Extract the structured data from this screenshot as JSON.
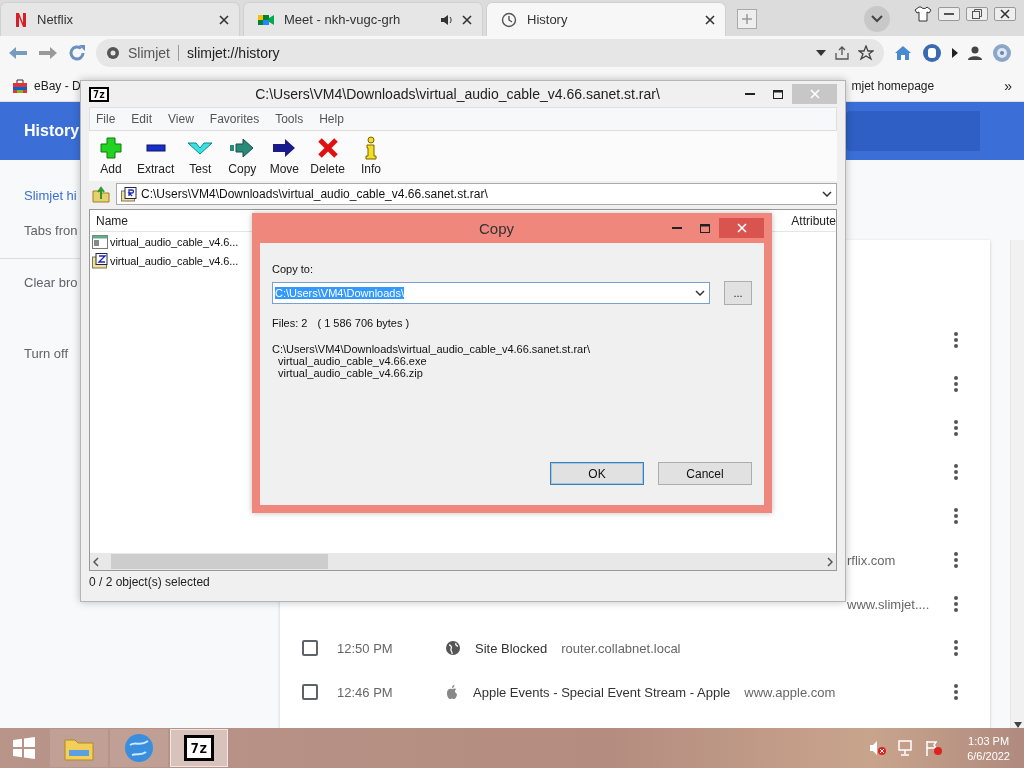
{
  "tabs": [
    {
      "label": "Netflix",
      "kind": "netflix",
      "selected": false,
      "audio": false
    },
    {
      "label": "Meet - nkh-vugc-grh",
      "kind": "meet",
      "selected": false,
      "audio": true
    },
    {
      "label": "History",
      "kind": "history",
      "selected": true,
      "audio": false
    }
  ],
  "address_bar": {
    "site": "Slimjet",
    "url": "slimjet://history"
  },
  "bookmarks": [
    {
      "label": "eBay - D",
      "kind": "ebay"
    },
    {
      "label": "mjet homepage",
      "kind": "covered"
    }
  ],
  "bookmarks_overflow": "»",
  "history_page": {
    "title": "History",
    "sidebar": [
      {
        "label": "Slimjet hi",
        "selected": true
      },
      {
        "label": "Tabs fron",
        "selected": false
      },
      {
        "label": "Clear bro",
        "selected": false
      },
      {
        "label": "Turn off",
        "selected": false
      }
    ],
    "rows": [
      {
        "kind": "covered"
      },
      {
        "kind": "covered"
      },
      {
        "kind": "covered"
      },
      {
        "kind": "covered"
      },
      {
        "kind": "covered"
      },
      {
        "kind": "covered",
        "tail": "rflix.com"
      },
      {
        "kind": "covered",
        "tail": "www.slimjet...."
      },
      {
        "kind": "full",
        "time": "12:50 PM",
        "favicon": {
          "kind": "globe"
        },
        "title": "Site Blocked",
        "domain": "router.collabnet.local",
        "checked": false
      },
      {
        "kind": "full",
        "time": "12:46 PM",
        "favicon": {
          "kind": "apple"
        },
        "title": "Apple Events - Special Event Stream - Apple",
        "domain": "www.apple.com",
        "checked": false
      }
    ]
  },
  "archive_window": {
    "icon_text": "7z",
    "title": "C:\\Users\\VM4\\Downloads\\virtual_audio_cable_v4.66.sanet.st.rar\\",
    "menu": [
      "File",
      "Edit",
      "View",
      "Favorites",
      "Tools",
      "Help"
    ],
    "toolbar": [
      {
        "label": "Add",
        "kind": "add"
      },
      {
        "label": "Extract",
        "kind": "extract"
      },
      {
        "label": "Test",
        "kind": "test"
      },
      {
        "label": "Copy",
        "kind": "copy"
      },
      {
        "label": "Move",
        "kind": "move"
      },
      {
        "label": "Delete",
        "kind": "delete"
      },
      {
        "label": "Info",
        "kind": "info"
      }
    ],
    "path": "C:\\Users\\VM4\\Downloads\\virtual_audio_cable_v4.66.sanet.st.rar\\",
    "columns": [
      "Name",
      "Attribute"
    ],
    "files": [
      {
        "name": "virtual_audio_cable_v4.6...",
        "kind": "exe",
        "selected": false
      },
      {
        "name": "virtual_audio_cable_v4.6...",
        "kind": "zip",
        "selected": false
      }
    ],
    "status": "0 / 2 object(s) selected"
  },
  "copy_dialog": {
    "title": "Copy",
    "label": "Copy to:",
    "value": "C:\\Users\\VM4\\Downloads\\",
    "value_selected": true,
    "browse": "...",
    "files_count": "Files: 2",
    "files_size": "( 1 586 706 bytes )",
    "source": "C:\\Users\\VM4\\Downloads\\virtual_audio_cable_v4.66.sanet.st.rar\\",
    "items": [
      "virtual_audio_cable_v4.66.exe",
      "virtual_audio_cable_v4.66.zip"
    ],
    "buttons": [
      {
        "label": "OK",
        "default": true
      },
      {
        "label": "Cancel",
        "default": false
      }
    ]
  },
  "taskbar": {
    "apps": [
      {
        "kind": "explorer",
        "selected": false
      },
      {
        "kind": "browser",
        "selected": false
      },
      {
        "kind": "archiver",
        "selected": true,
        "icon_text": "7z"
      }
    ],
    "time": "1:03 PM",
    "date": "6/6/2022"
  }
}
